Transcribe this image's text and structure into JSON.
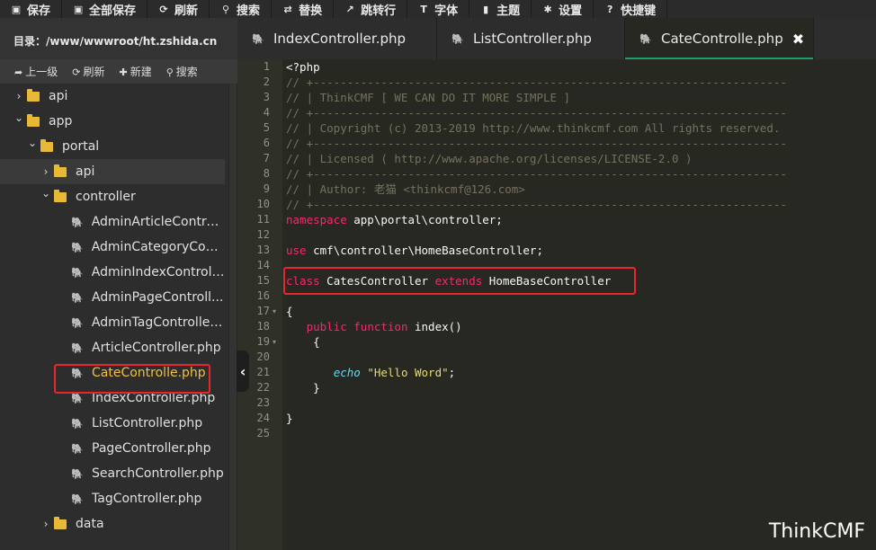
{
  "toolbar": [
    {
      "icon": "save-icon",
      "glyph": "▣",
      "label": "保存"
    },
    {
      "icon": "save-all-icon",
      "glyph": "▣",
      "label": "全部保存"
    },
    {
      "icon": "refresh-icon",
      "glyph": "⟳",
      "label": "刷新"
    },
    {
      "icon": "search-icon",
      "glyph": "⚲",
      "label": "搜索"
    },
    {
      "icon": "replace-icon",
      "glyph": "⇄",
      "label": "替换"
    },
    {
      "icon": "goto-line-icon",
      "glyph": "↗",
      "label": "跳转行"
    },
    {
      "icon": "font-icon",
      "glyph": "T",
      "label": "字体"
    },
    {
      "icon": "theme-icon",
      "glyph": "▮",
      "label": "主题"
    },
    {
      "icon": "settings-icon",
      "glyph": "✱",
      "label": "设置"
    },
    {
      "icon": "shortcut-icon",
      "glyph": "?",
      "label": "快捷键"
    }
  ],
  "sidebar": {
    "dir_label": "目录：/www/wwwroot/ht.zshida.cn",
    "actions": [
      {
        "icon": "up-level-icon",
        "glyph": "➦",
        "label": "上一级"
      },
      {
        "icon": "refresh-icon",
        "glyph": "⟳",
        "label": "刷新"
      },
      {
        "icon": "new-icon",
        "glyph": "✚",
        "label": "新建"
      },
      {
        "icon": "search-icon",
        "glyph": "⚲",
        "label": "搜索"
      }
    ],
    "tree": [
      {
        "kind": "folder",
        "depth": 0,
        "expanded": false,
        "label": "api"
      },
      {
        "kind": "folder",
        "depth": 0,
        "expanded": true,
        "label": "app"
      },
      {
        "kind": "folder",
        "depth": 1,
        "expanded": true,
        "label": "portal"
      },
      {
        "kind": "folder",
        "depth": 2,
        "expanded": false,
        "label": "api",
        "selected": true
      },
      {
        "kind": "folder",
        "depth": 2,
        "expanded": true,
        "label": "controller"
      },
      {
        "kind": "file",
        "depth": 3,
        "label": "AdminArticleControl..."
      },
      {
        "kind": "file",
        "depth": 3,
        "label": "AdminCategoryCont..."
      },
      {
        "kind": "file",
        "depth": 3,
        "label": "AdminIndexControll..."
      },
      {
        "kind": "file",
        "depth": 3,
        "label": "AdminPageControll..."
      },
      {
        "kind": "file",
        "depth": 3,
        "label": "AdminTagController..."
      },
      {
        "kind": "file",
        "depth": 3,
        "label": "ArticleController.php"
      },
      {
        "kind": "file",
        "depth": 3,
        "label": "CateControlle.php",
        "active": true
      },
      {
        "kind": "file",
        "depth": 3,
        "label": "IndexController.php"
      },
      {
        "kind": "file",
        "depth": 3,
        "label": "ListController.php"
      },
      {
        "kind": "file",
        "depth": 3,
        "label": "PageController.php"
      },
      {
        "kind": "file",
        "depth": 3,
        "label": "SearchController.php"
      },
      {
        "kind": "file",
        "depth": 3,
        "label": "TagController.php"
      },
      {
        "kind": "folder",
        "depth": 2,
        "expanded": false,
        "label": "data"
      }
    ],
    "collapse_glyph": "‹"
  },
  "tabs": [
    {
      "label": "IndexController.php",
      "active": false
    },
    {
      "label": "ListController.php",
      "active": false
    },
    {
      "label": "CateControlle.php",
      "active": true,
      "close": "✖"
    }
  ],
  "editor": {
    "lines": [
      {
        "n": "1",
        "fold": "",
        "tokens": [
          [
            "",
            "<?php"
          ]
        ]
      },
      {
        "n": "2",
        "fold": "",
        "tokens": [
          [
            "cm",
            "// +----------------------------------------------------------------------"
          ]
        ]
      },
      {
        "n": "3",
        "fold": "",
        "tokens": [
          [
            "cm",
            "// | ThinkCMF [ WE CAN DO IT MORE SIMPLE ]"
          ]
        ]
      },
      {
        "n": "4",
        "fold": "",
        "tokens": [
          [
            "cm",
            "// +----------------------------------------------------------------------"
          ]
        ]
      },
      {
        "n": "5",
        "fold": "",
        "tokens": [
          [
            "cm",
            "// | Copyright (c) 2013-2019 http://www.thinkcmf.com All rights reserved."
          ]
        ]
      },
      {
        "n": "6",
        "fold": "",
        "tokens": [
          [
            "cm",
            "// +----------------------------------------------------------------------"
          ]
        ]
      },
      {
        "n": "7",
        "fold": "",
        "tokens": [
          [
            "cm",
            "// | Licensed ( http://www.apache.org/licenses/LICENSE-2.0 )"
          ]
        ]
      },
      {
        "n": "8",
        "fold": "",
        "tokens": [
          [
            "cm",
            "// +----------------------------------------------------------------------"
          ]
        ]
      },
      {
        "n": "9",
        "fold": "",
        "tokens": [
          [
            "cm",
            "// | Author: 老猫 <thinkcmf@126.com>"
          ]
        ]
      },
      {
        "n": "10",
        "fold": "",
        "tokens": [
          [
            "cm",
            "// +----------------------------------------------------------------------"
          ]
        ]
      },
      {
        "n": "11",
        "fold": "",
        "tokens": [
          [
            "kw",
            "namespace"
          ],
          [
            "",
            " app\\portal\\controller;"
          ]
        ]
      },
      {
        "n": "12",
        "fold": "",
        "tokens": []
      },
      {
        "n": "13",
        "fold": "",
        "tokens": [
          [
            "kw",
            "use"
          ],
          [
            "",
            " cmf\\controller\\HomeBaseController;"
          ]
        ]
      },
      {
        "n": "14",
        "fold": "",
        "tokens": []
      },
      {
        "n": "15",
        "fold": "",
        "tokens": [
          [
            "kw",
            "class"
          ],
          [
            "",
            " CatesController "
          ],
          [
            "kw",
            "extends"
          ],
          [
            "",
            " HomeBaseController"
          ]
        ]
      },
      {
        "n": "16",
        "fold": "",
        "tokens": []
      },
      {
        "n": "17",
        "fold": "▾",
        "tokens": [
          [
            "",
            "{"
          ]
        ]
      },
      {
        "n": "18",
        "fold": "",
        "tokens": [
          [
            "",
            "   "
          ],
          [
            "kw",
            "public"
          ],
          [
            "",
            " "
          ],
          [
            "kw",
            "function"
          ],
          [
            "",
            " index()"
          ]
        ]
      },
      {
        "n": "19",
        "fold": "▾",
        "tokens": [
          [
            "",
            "    {"
          ]
        ]
      },
      {
        "n": "20",
        "fold": "",
        "tokens": []
      },
      {
        "n": "21",
        "fold": "",
        "tokens": [
          [
            "",
            "       "
          ],
          [
            "fn",
            "echo"
          ],
          [
            "",
            " "
          ],
          [
            "st",
            "\"Hello Word\""
          ],
          [
            "",
            ";"
          ]
        ]
      },
      {
        "n": "22",
        "fold": "",
        "tokens": [
          [
            "",
            "    }"
          ]
        ]
      },
      {
        "n": "23",
        "fold": "",
        "tokens": []
      },
      {
        "n": "24",
        "fold": "",
        "tokens": [
          [
            "",
            "}"
          ]
        ]
      },
      {
        "n": "25",
        "fold": "",
        "tokens": []
      }
    ]
  },
  "watermark": "ThinkCMF",
  "colors": {
    "highlight_box": "#e8272a",
    "active_file": "#f0c040",
    "active_tab_underline": "#1f9e6a"
  }
}
